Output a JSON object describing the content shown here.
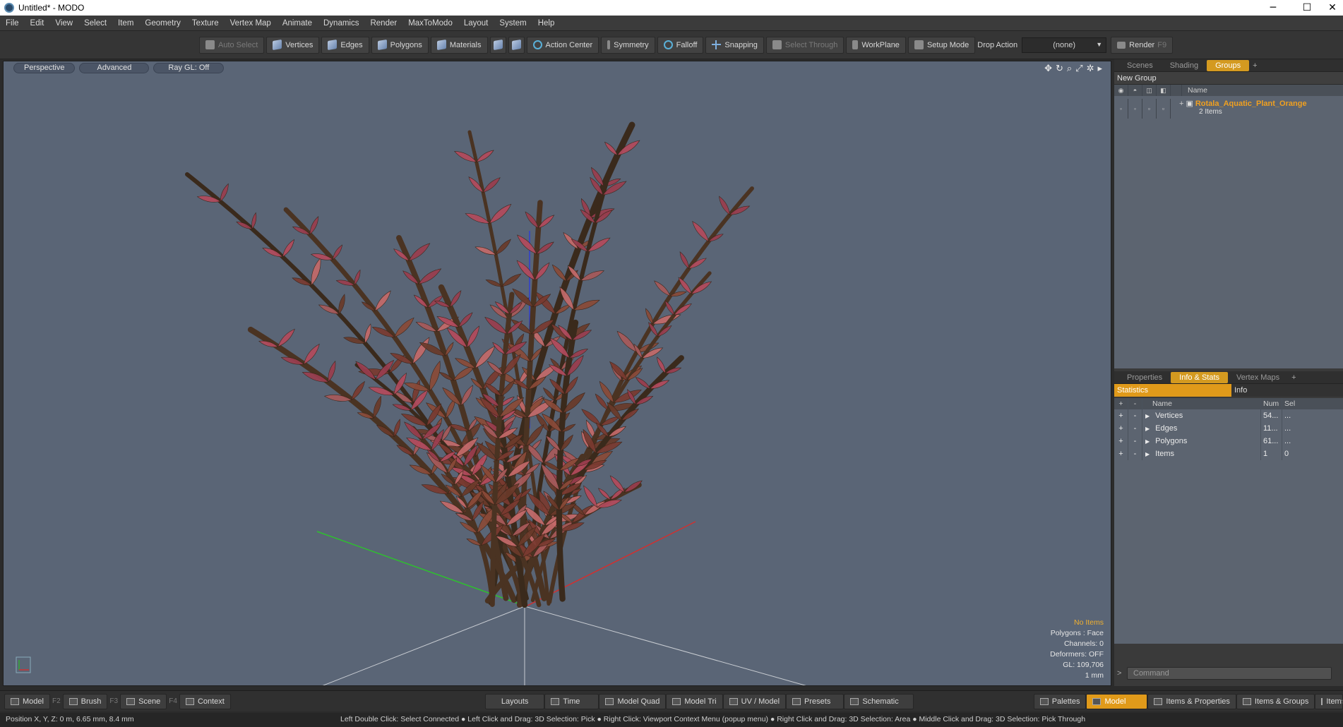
{
  "window": {
    "title": "Untitled* - MODO",
    "minimize": "─",
    "maximize": "☐",
    "close": "✕"
  },
  "menu": [
    "File",
    "Edit",
    "View",
    "Select",
    "Item",
    "Geometry",
    "Texture",
    "Vertex Map",
    "Animate",
    "Dynamics",
    "Render",
    "MaxToModo",
    "Layout",
    "System",
    "Help"
  ],
  "toolbar": {
    "auto_select": "Auto Select",
    "vertices": "Vertices",
    "edges": "Edges",
    "polygons": "Polygons",
    "materials": "Materials",
    "action_center": "Action Center",
    "symmetry": "Symmetry",
    "falloff": "Falloff",
    "snapping": "Snapping",
    "select_through": "Select Through",
    "workplane": "WorkPlane",
    "setup_mode": "Setup Mode",
    "drop_action_label": "Drop Action",
    "drop_action_value": "(none)",
    "render": "Render",
    "render_key": "F9"
  },
  "viewport": {
    "perspective": "Perspective",
    "advanced": "Advanced",
    "raygl": "Ray GL: Off",
    "info": {
      "items": "No Items",
      "polygons": "Polygons : Face",
      "channels": "Channels: 0",
      "deformers": "Deformers: OFF",
      "gl": "GL: 109,706",
      "scale": "1 mm"
    }
  },
  "groups_panel": {
    "tabs": [
      "Scenes",
      "Shading",
      "Groups"
    ],
    "active_tab": "Groups",
    "new_group": "New Group",
    "name_header": "Name",
    "group_name": "Rotala_Aquatic_Plant_Orange",
    "group_sub": "2 Items"
  },
  "info_panel": {
    "tabs": [
      "Properties",
      "Info & Stats",
      "Vertex Maps"
    ],
    "active_tab": "Info & Stats",
    "stat_tab": "Statistics",
    "info_tab": "Info",
    "headers": {
      "name": "Name",
      "num": "Num",
      "sel": "Sel"
    },
    "rows": [
      {
        "name": "Vertices",
        "num": "54...",
        "sel": "..."
      },
      {
        "name": "Edges",
        "num": "11...",
        "sel": "..."
      },
      {
        "name": "Polygons",
        "num": "61...",
        "sel": "..."
      },
      {
        "name": "Items",
        "num": "1",
        "sel": "0"
      }
    ],
    "command_placeholder": "Command"
  },
  "bottom": {
    "model": "Model",
    "model_key": "F2",
    "brush": "Brush",
    "brush_key": "F3",
    "scene": "Scene",
    "scene_key": "F4",
    "context": "Context",
    "layouts": "Layouts",
    "time": "Time",
    "model_quad": "Model Quad",
    "model_tri": "Model Tri",
    "uv_model": "UV / Model",
    "presets": "Presets",
    "schematic": "Schematic",
    "palettes": "Palettes",
    "model_active": "Model",
    "items_properties": "Items & Properties",
    "items_groups": "Items & Groups",
    "items_shading": "Items & Shadin"
  },
  "status": {
    "position": "Position X, Y, Z:   0 m, 6.65 mm, 8.4 mm",
    "hint": "Left Double Click: Select Connected ● Left Click and Drag: 3D Selection: Pick ● Right Click: Viewport Context Menu (popup menu) ● Right Click and Drag: 3D Selection: Area ● Middle Click and Drag: 3D Selection: Pick Through"
  },
  "colors": {
    "accent": "#e09a1a",
    "viewport_bg": "#5a6576",
    "group_name": "#f0a020"
  }
}
